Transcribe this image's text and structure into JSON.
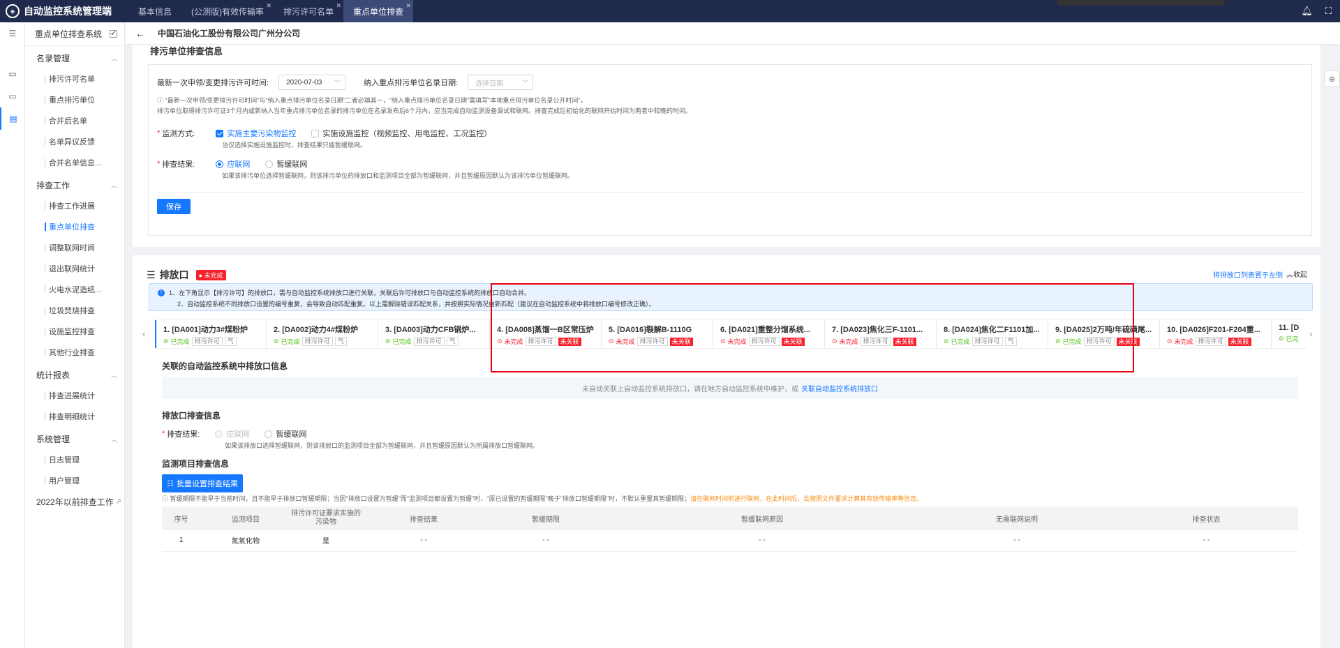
{
  "app": {
    "title": "自动监控系统管理端",
    "logo_icon": "shield-icon"
  },
  "tabs": [
    {
      "label": "基本信息",
      "closable": false,
      "active": false
    },
    {
      "label": "(公测版)有效传输率",
      "closable": true,
      "active": false
    },
    {
      "label": "排污许可名单",
      "closable": true,
      "active": false
    },
    {
      "label": "重点单位排查",
      "closable": true,
      "active": true
    }
  ],
  "topbar": {
    "icons": [
      "bell-icon",
      "expand-icon"
    ]
  },
  "sidebar": {
    "title": "重点单位排查系统",
    "groups": [
      {
        "label": "名录管理",
        "items": [
          "排污许可名单",
          "重点排污单位",
          "合并后名单",
          "名单异议反馈",
          "合并名单信息..."
        ]
      },
      {
        "label": "排查工作",
        "items": [
          "排查工作进展",
          "重点单位排查",
          "调整联网时间",
          "退出联网统计",
          "火电水泥造纸...",
          "垃圾焚烧排查",
          "设施监控排查",
          "其他行业排查"
        ]
      },
      {
        "label": "统计报表",
        "items": [
          "排查进展统计",
          "排查明细统计"
        ]
      },
      {
        "label": "系统管理",
        "items": [
          "日志管理",
          "用户管理"
        ]
      }
    ],
    "active_item": "重点单位排查",
    "extra": "2022年以前排查工作"
  },
  "header": {
    "company": "中国石油化工股份有限公司广州分公司"
  },
  "section1": {
    "title": "排污单位排查信息",
    "permit_label": "最新一次申领/变更排污许可时间:",
    "permit_value": "2020-07-03",
    "list_label": "纳入重点排污单位名录日期:",
    "list_placeholder": "选择日期",
    "hint1": "\"最新一次申领/变更排污许可时间\"与\"纳入重点排污单位名录日期\"二者必填其一，\"纳入重点排污单位名录日期\"需填写\"本地重点排污单位名录公开时间\"。",
    "hint2": "排污单位取得排污许可证3个月内或新纳入当年重点排污单位名录的排污单位在名录发布后6个月内，应当完成自动监测设备调试和联网。排查完成后初始化的联网开始时间为两者中较晚的时间。",
    "method_label": "监测方式:",
    "method_opt1": "实施主要污染物监控",
    "method_opt2": "实施设施监控（视频监控、用电监控、工况监控）",
    "method_hint": "当仅选择实施设施监控时，排查结果只能暂缓联网。",
    "result_label": "排查结果:",
    "result_opt1": "应联网",
    "result_opt2": "暂缓联网",
    "result_hint": "如果该排污单位选择暂缓联网，则该排污单位的排放口和监测项目全部为暂缓联网，并且暂缓原因默认为该排污单位暂缓联网。",
    "save": "保存"
  },
  "section2": {
    "title": "排放口",
    "status_badge": "未完成",
    "pin_link": "将排放口列表置于左侧",
    "collapse": "收起",
    "notice1": "1、左下角显示【排污许可】的排放口，需与自动监控系统排放口进行关联，关联后许可排放口与自动监控系统的排放口自动合并。",
    "notice2": "2、自动监控系统不同排放口设置的编号重复，会导致自动匹配重复。以上需解除错误匹配关系，并按照实际情况重新匹配（建议在自动监控系统中将排放口编号修改正确）。",
    "outlets": [
      {
        "name": "1. [DA001]动力3#煤粉炉",
        "status": "已完成",
        "done": true,
        "tag": "排污许可",
        "extra": "气"
      },
      {
        "name": "2. [DA002]动力4#煤粉炉",
        "status": "已完成",
        "done": true,
        "tag": "排污许可",
        "extra": "气"
      },
      {
        "name": "3. [DA003]动力CFB锅炉...",
        "status": "已完成",
        "done": true,
        "tag": "排污许可",
        "extra": "气"
      },
      {
        "name": "4. [DA008]蒸馏一B区常压炉",
        "status": "未完成",
        "done": false,
        "tag": "排污许可",
        "extra": "未关联"
      },
      {
        "name": "5. [DA016]裂解B-1110G",
        "status": "未完成",
        "done": false,
        "tag": "排污许可",
        "extra": "未关联"
      },
      {
        "name": "6. [DA021]重整分馏系统...",
        "status": "未完成",
        "done": false,
        "tag": "排污许可",
        "extra": "未关联"
      },
      {
        "name": "7. [DA023]焦化三F-1101...",
        "status": "未完成",
        "done": false,
        "tag": "排污许可",
        "extra": "未关联"
      },
      {
        "name": "8. [DA024]焦化二F1101加...",
        "status": "已完成",
        "done": true,
        "tag": "排污许可",
        "extra": "气"
      },
      {
        "name": "9. [DA025]2万吨/年硫磺尾...",
        "status": "已完成",
        "done": true,
        "tag": "排污许可",
        "extra": "未关联"
      },
      {
        "name": "10. [DA026]F201-F204重...",
        "status": "未完成",
        "done": false,
        "tag": "排污许可",
        "extra": "未关联"
      },
      {
        "name": "11. [D",
        "status": "已完",
        "done": true,
        "tag": "",
        "extra": ""
      }
    ],
    "assoc_title": "关联的自动监控系统中排放口信息",
    "assoc_empty": "未自动关联上自动监控系统排放口，请在地方自动监控系统中维护，或",
    "assoc_link": "关联自动监控系统排放口",
    "check_title": "排放口排查信息",
    "check_label": "排查结果:",
    "check_opt1": "应联网",
    "check_opt2": "暂缓联网",
    "check_hint": "如果该排放口选择暂缓联网，则该排放口的监测项目全部为暂缓联网，并且暂缓原因默认为所属排放口暂缓联网。",
    "items_title": "监测项目排查信息",
    "batch_btn": "批量设置排查结果",
    "items_hint": "暂缓期限不能早于当前时间，且不能早于排放口暂缓期限；当因\"排放口设置为暂缓\"而\"监测项目都设置为暂缓\"时，\"原已设置的暂缓期限\"晚于\"排放口暂缓期限\"时，不默认重置其暂缓期限；",
    "items_warn": "请在联网时间前进行联网，在此时间后，会按照文件要求计算其有效传输率等信息。",
    "table": {
      "headers": [
        "序号",
        "监测项目",
        "排污许可证要求实施的污染物",
        "排查结果",
        "暂缓期限",
        "暂缓联网原因",
        "无需联网说明",
        "排查状态"
      ],
      "rows": [
        [
          "1",
          "氮氧化物",
          "是",
          "- -",
          "- -",
          "- -",
          "- -",
          "- -"
        ]
      ]
    }
  }
}
